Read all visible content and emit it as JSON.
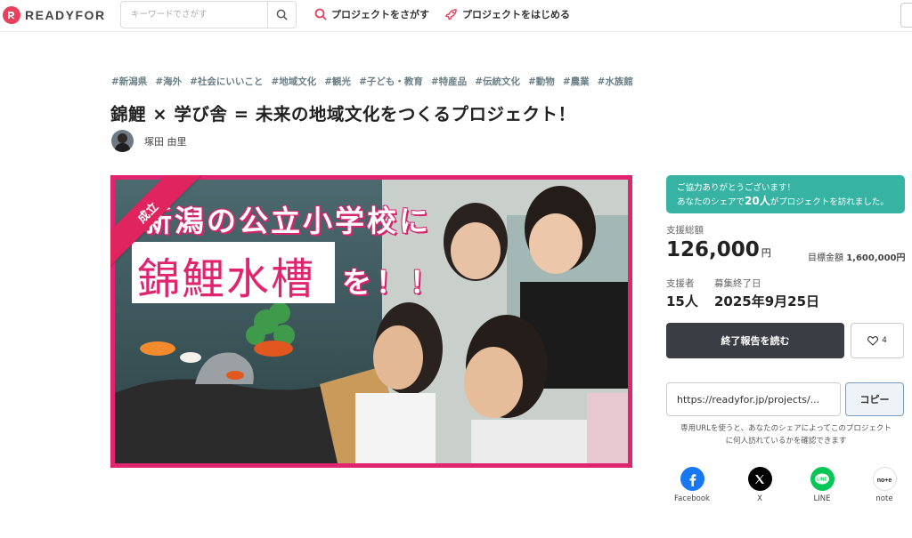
{
  "header": {
    "logo_text": "READYFOR",
    "search_placeholder": "キーワードでさがす",
    "nav_find": "プロジェクトをさがす",
    "nav_start": "プロジェクトをはじめる"
  },
  "project": {
    "tags": [
      "#新潟県",
      "#海外",
      "#社会にいいこと",
      "#地域文化",
      "#観光",
      "#子ども・教育",
      "#特産品",
      "#伝統文化",
      "#動物",
      "#農業",
      "#水族館"
    ],
    "title": "錦鯉 × 学び舎 = 未来の地域文化をつくるプロジェクト！",
    "author": "塚田 由里"
  },
  "hero": {
    "ribbon": "成立",
    "line1": "新潟の公立小学校に",
    "line2": "錦鯉水槽",
    "line3": "を！！"
  },
  "panel": {
    "thanks_line1": "ご協力ありがとうございます！",
    "thanks_pre": "あなたのシェアで",
    "thanks_count": "20人",
    "thanks_post": "がプロジェクトを訪れました。",
    "total_label": "支援総額",
    "total_value": "126,000",
    "yen": "円",
    "goal_label": "目標金額",
    "goal_value": "1,600,000円",
    "supporters_label": "支援者",
    "supporters_value": "15人",
    "end_label": "募集終了日",
    "end_value": "2025年9月25日",
    "report_button": "終了報告を読む",
    "like_count": "4",
    "url_value": "https://readyfor.jp/projects/...",
    "copy_button": "コピー",
    "url_note": "専用URLを使うと、あなたのシェアによってこのプロジェクトに何人訪れているかを確認できます"
  },
  "share": [
    {
      "label": "Facebook"
    },
    {
      "label": "X"
    },
    {
      "label": "LINE"
    },
    {
      "label": "note"
    }
  ],
  "colors": {
    "brand": "#e8415e",
    "hero_border": "#e0246e",
    "thanks_bg": "#37b3a4",
    "report_btn": "#3a3e44",
    "facebook": "#1877f2",
    "line": "#06c755"
  }
}
